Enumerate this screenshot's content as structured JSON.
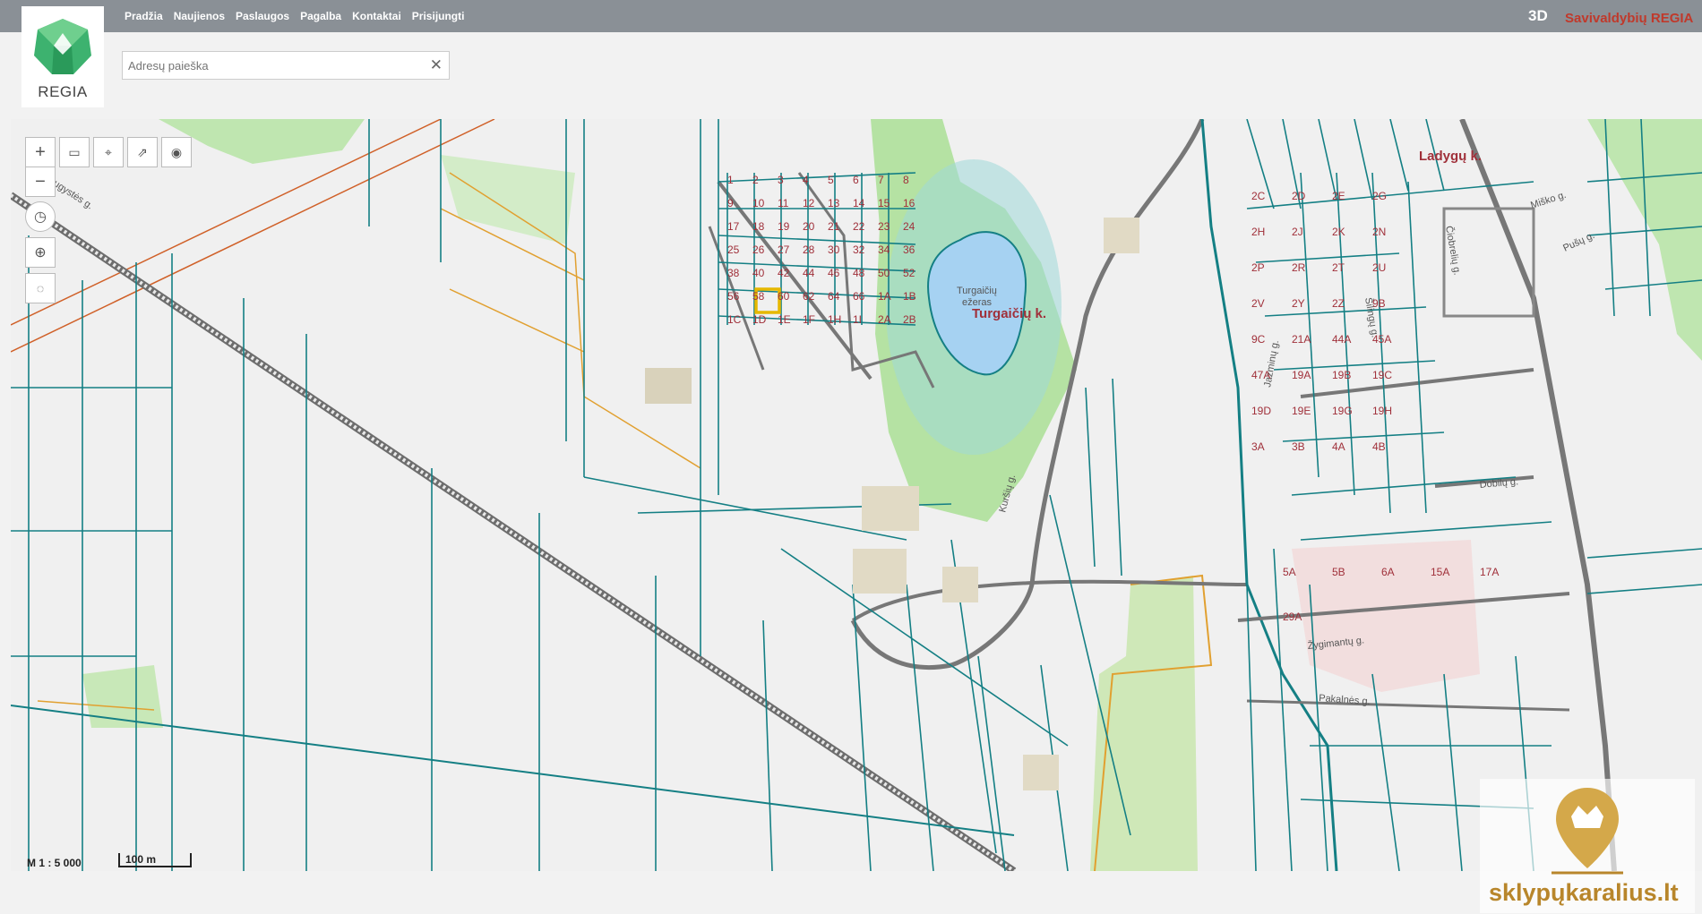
{
  "nav": [
    "Pradžia",
    "Naujienos",
    "Paslaugos",
    "Pagalba",
    "Kontaktai",
    "Prisijungti"
  ],
  "header": {
    "btn3d": "3D",
    "municipality": "Savivaldybių REGIA"
  },
  "logo": {
    "text": "REGIA"
  },
  "search": {
    "placeholder": "Adresų paieška"
  },
  "map": {
    "lake_name": "Turgaičių ežeras",
    "village": "Turgaičių k.",
    "village2": "Ladygų k.",
    "streets": [
      "Draugystės g.",
      "Žygimantų g.",
      "Pakalnės g.",
      "Dobilų g.",
      "Miško g.",
      "Pušų g.",
      "Čiobrelių g.",
      "Jazminų g.",
      "Šilingų g.",
      "Kuršių g."
    ],
    "parcels": [
      "1",
      "2",
      "3",
      "4",
      "5",
      "6",
      "7",
      "8",
      "9",
      "10",
      "11",
      "12",
      "13",
      "14",
      "15",
      "16",
      "17",
      "18",
      "19",
      "20",
      "21",
      "22",
      "23",
      "24",
      "25",
      "26",
      "27",
      "28",
      "30",
      "32",
      "34",
      "36",
      "38",
      "40",
      "42",
      "44",
      "46",
      "48",
      "50",
      "52",
      "56",
      "58",
      "60",
      "62",
      "64",
      "66",
      "1A",
      "1B",
      "1C",
      "1D",
      "1E",
      "1F",
      "1H",
      "1I",
      "2A",
      "2B",
      "2C",
      "2D",
      "2E",
      "2G",
      "2H",
      "2J",
      "2K",
      "2N",
      "2P",
      "2R",
      "2T",
      "2U",
      "2V",
      "2Y",
      "2Z",
      "9B",
      "9C",
      "21A",
      "44A",
      "45A",
      "47A",
      "19A",
      "19B",
      "19C",
      "19D",
      "19E",
      "19G",
      "19H",
      "3A",
      "3B",
      "4A",
      "4B",
      "5A",
      "5B",
      "6A",
      "15A",
      "17A",
      "29A"
    ]
  },
  "scale": {
    "ratio": "M 1 : 5 000",
    "bar": "100 m"
  },
  "brand": "sklypųkaralius.lt",
  "colors": {
    "parcel": "#147f84",
    "label": "#a0303a",
    "lake": "#a6d2f2",
    "forest": "#b7e3a8",
    "road": "#777777",
    "highlight": "#e6b800",
    "powerline": "#d06028",
    "topbar": "#8a9096"
  }
}
